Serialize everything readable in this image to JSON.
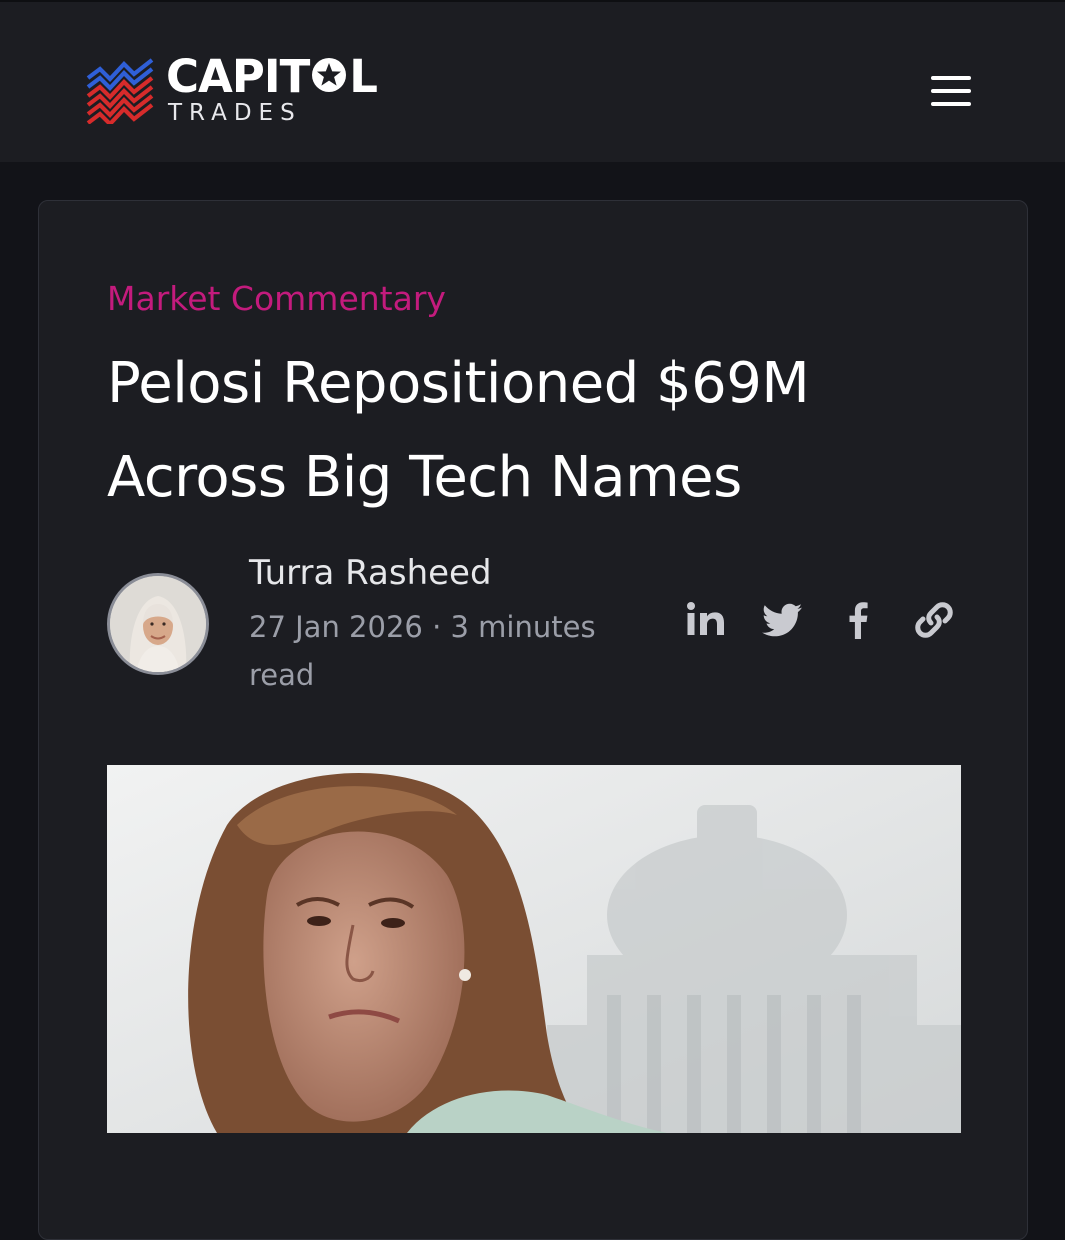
{
  "header": {
    "logo_word_left": "CAPIT",
    "logo_word_right": "L",
    "logo_sub": "TRADES",
    "menu_icon": "hamburger-menu-icon"
  },
  "article": {
    "category": "Market Commentary",
    "title": "Pelosi Repositioned $69M Across Big Tech Names",
    "author": "Turra Rasheed",
    "meta": "27 Jan 2026 · 3 minutes read"
  },
  "share": {
    "icons": [
      "linkedin-icon",
      "twitter-icon",
      "facebook-icon",
      "link-icon"
    ]
  },
  "colors": {
    "background": "#121318",
    "surface": "#1c1d22",
    "accent": "#c31b7d",
    "text": "#ffffff",
    "muted": "#9b9ea8",
    "icon": "#c9cad0",
    "logo_blue": "#2f5fd7",
    "logo_red": "#d62b2b"
  }
}
